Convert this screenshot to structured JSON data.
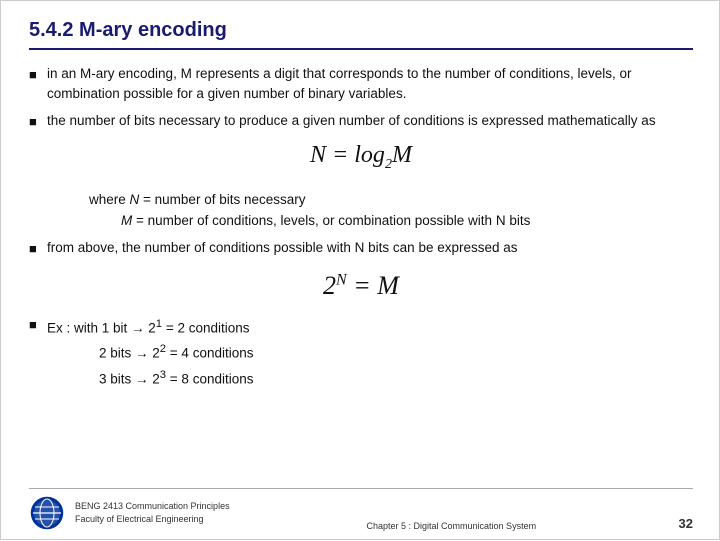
{
  "slide": {
    "title": "5.4.2 M-ary encoding",
    "bullets": [
      {
        "text": "in an M-ary encoding, M represents a digit that corresponds to the number of conditions, levels, or combination possible for a given number of binary variables."
      },
      {
        "text": "the number of bits necessary to produce a given number of conditions is expressed mathematically as"
      }
    ],
    "formula1": {
      "left": "N = log",
      "sub": "2",
      "right": "M"
    },
    "where_lines": [
      "where N = number of bits necessary",
      "M = number of conditions, levels, or combination possible with N bits"
    ],
    "from_above": "from above, the number of conditions possible with N bits can be expressed as",
    "formula2": {
      "base": "2",
      "exp": "N",
      "equals": "= M"
    },
    "ex": {
      "label": "Ex :",
      "lines": [
        "with 1 bit → 2¹ = 2 conditions",
        "2 bits → 2² = 4 conditions",
        "3 bits → 2³ = 8 conditions"
      ]
    },
    "footer": {
      "institution_line1": "BENG 2413 Communication Principles",
      "institution_line2": "Faculty of Electrical Engineering",
      "chapter": "Chapter 5 : Digital Communication System",
      "page": "32"
    }
  }
}
